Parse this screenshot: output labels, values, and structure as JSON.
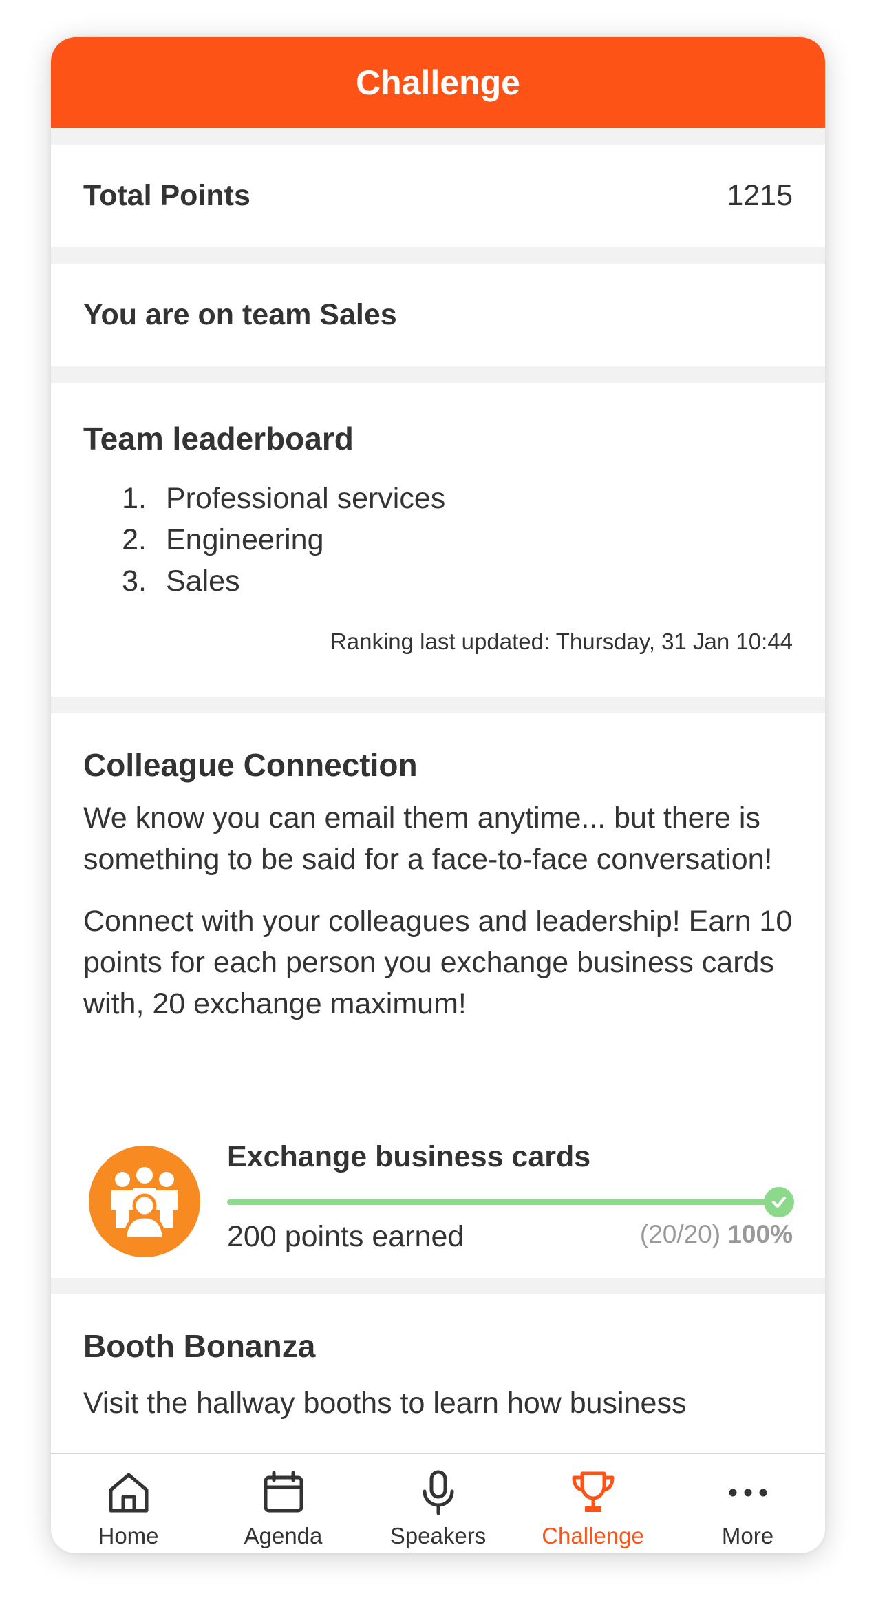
{
  "header": {
    "title": "Challenge"
  },
  "total_points": {
    "label": "Total Points",
    "value": "1215"
  },
  "team": {
    "label": "You are on team Sales"
  },
  "leaderboard": {
    "title": "Team leaderboard",
    "items": [
      {
        "rank": "1.",
        "name": "Professional services"
      },
      {
        "rank": "2.",
        "name": "Engineering"
      },
      {
        "rank": "3.",
        "name": "Sales"
      }
    ],
    "updated": "Ranking last updated: Thursday, 31 Jan 10:44"
  },
  "colleague_connection": {
    "title": "Colleague Connection",
    "paragraph1": "We know you can email them anytime... but there is something to be said for a face-to-face conversation!",
    "paragraph2": "Connect with your colleagues and leadership! Earn 10 points for each person you exchange business cards with, 20 exchange maximum!",
    "task": {
      "title": "Exchange business cards",
      "earned": "200 points earned",
      "count": "(20/20)",
      "percent": "100%",
      "progress": 1.0,
      "icon": "people-group-icon",
      "badge_color": "#f78a21",
      "bar_color": "#8dd98b"
    }
  },
  "booth_bonanza": {
    "title": "Booth Bonanza",
    "paragraph": "Visit the hallway booths to learn how business"
  },
  "tabbar": {
    "items": [
      {
        "label": "Home",
        "icon": "home-icon",
        "active": false
      },
      {
        "label": "Agenda",
        "icon": "calendar-icon",
        "active": false
      },
      {
        "label": "Speakers",
        "icon": "microphone-icon",
        "active": false
      },
      {
        "label": "Challenge",
        "icon": "trophy-icon",
        "active": true
      },
      {
        "label": "More",
        "icon": "more-dots-icon",
        "active": false
      }
    ]
  },
  "colors": {
    "accent": "#fd5316",
    "text": "#333333",
    "muted": "#999999"
  }
}
